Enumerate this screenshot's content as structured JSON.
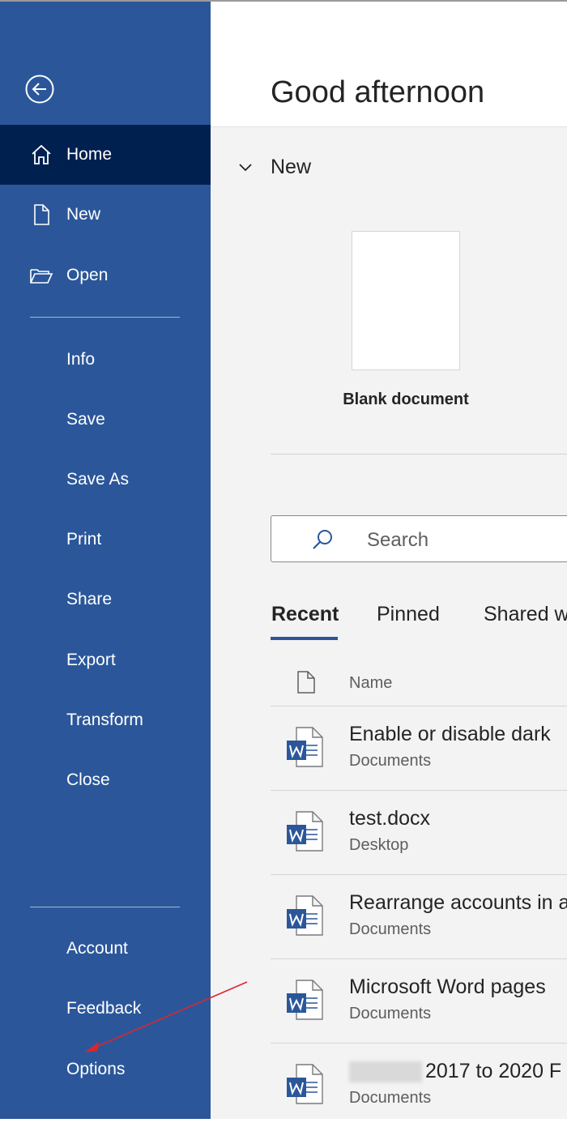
{
  "sidebar": {
    "primary": [
      {
        "label": "Home",
        "icon": "home-icon",
        "active": true
      },
      {
        "label": "New",
        "icon": "new-document-icon"
      },
      {
        "label": "Open",
        "icon": "open-folder-icon"
      }
    ],
    "secondary": [
      "Info",
      "Save",
      "Save As",
      "Print",
      "Share",
      "Export",
      "Transform",
      "Close"
    ],
    "bottom": [
      "Account",
      "Feedback",
      "Options"
    ]
  },
  "main": {
    "greeting": "Good afternoon",
    "new_section": {
      "title": "New",
      "blank_label": "Blank document"
    },
    "search": {
      "placeholder": "Search"
    },
    "tabs": [
      "Recent",
      "Pinned",
      "Shared w"
    ],
    "columns": {
      "name": "Name"
    },
    "files": [
      {
        "name": "Enable or disable dark",
        "location": "Documents"
      },
      {
        "name": "test.docx",
        "location": "Desktop"
      },
      {
        "name": "Rearrange accounts in a",
        "location": "Documents"
      },
      {
        "name": "Microsoft Word pages",
        "location": "Documents"
      },
      {
        "name": "2017 to 2020 F",
        "location": "Documents"
      }
    ]
  },
  "colors": {
    "sidebar": "#2b579a",
    "sidebar_active": "#002050",
    "annotation_arrow": "#d9262e"
  }
}
